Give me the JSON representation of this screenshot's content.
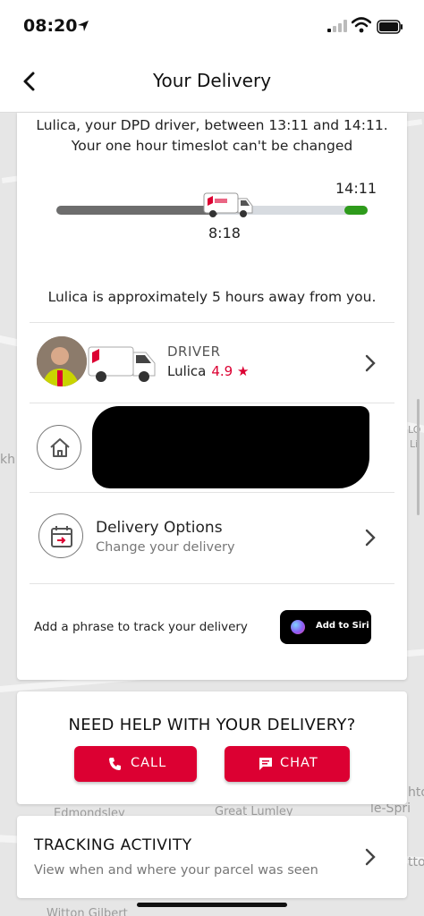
{
  "status_bar": {
    "time": "08:20"
  },
  "header": {
    "title": "Your Delivery"
  },
  "intro": {
    "line1": "Lulica, your DPD driver, between 13:11 and 14:11.",
    "line2": "Your one hour timeslot can't be changed"
  },
  "timeline": {
    "end_time": "14:11",
    "current_time": "8:18"
  },
  "eta_text": "Lulica is approximately 5 hours away from you.",
  "driver": {
    "label": "DRIVER",
    "name": "Lulica",
    "rating": "4.9 ★"
  },
  "delivery_options": {
    "title": "Delivery Options",
    "subtitle": "Change your delivery"
  },
  "siri": {
    "prompt": "Add a phrase to track your delivery",
    "button_label": "Add to Siri"
  },
  "help": {
    "title": "NEED HELP WITH YOUR DELIVERY?",
    "call_label": "CALL",
    "chat_label": "CHAT"
  },
  "tracking": {
    "title": "TRACKING ACTIVITY",
    "subtitle": "View when and where your parcel was seen"
  },
  "map_labels": [
    "Edmondsley",
    "Great Lumley",
    "le-Spri",
    "Witton Gilbert",
    "kh",
    "hto",
    "tto",
    "LO",
    "Li"
  ],
  "colors": {
    "brand_red": "#dc0032",
    "progress_green": "#2e9b1b",
    "progress_grey": "#6d6d6d"
  }
}
